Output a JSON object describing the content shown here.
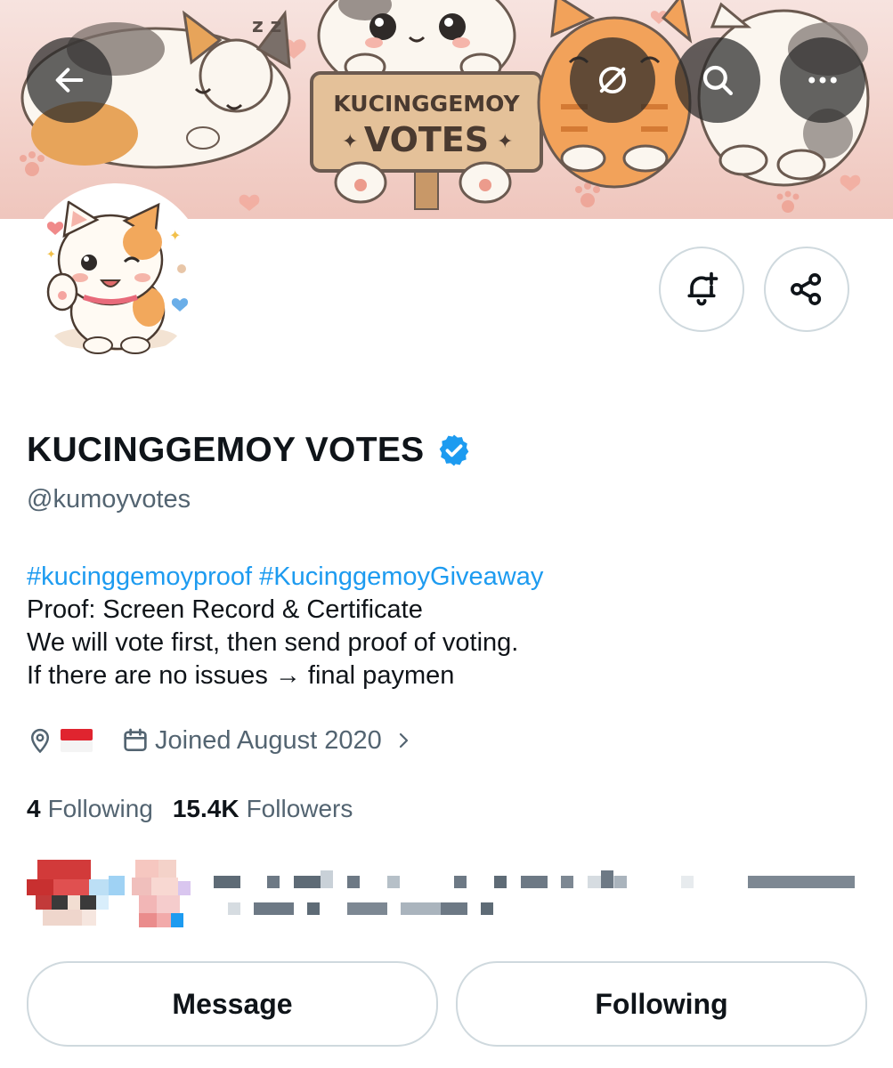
{
  "banner": {
    "sign_line1": "KUCINGGEMOY",
    "sign_line2": "VOTES",
    "zzz": "z z"
  },
  "top_bar": {
    "back_icon": "arrow-left-icon",
    "grok_icon": "slash-circle-icon",
    "search_icon": "search-icon",
    "more_icon": "ellipsis-icon"
  },
  "actions": {
    "notify_icon": "bell-plus-icon",
    "share_icon": "share-icon"
  },
  "profile": {
    "display_name": "KUCINGGEMOY VOTES",
    "verified_icon": "verified-badge-icon",
    "handle": "@kumoyvotes",
    "bio": {
      "hashtag1": "#kucinggemoyproof",
      "hashtag2": "#KucinggemoyGiveaway",
      "line2": "Proof: Screen Record & Certificate",
      "line3": "We will vote first, then send proof of voting.",
      "line4": "If there are no issues → final paymen"
    },
    "location_icon": "map-pin-icon",
    "location_flag": "flag-indonesia-icon",
    "joined_icon": "calendar-icon",
    "joined": "Joined August 2020",
    "joined_chevron": "chevron-right-icon"
  },
  "stats": {
    "following_count": "4",
    "following_label": "Following",
    "followers_count": "15.4K",
    "followers_label": "Followers"
  },
  "buttons": {
    "message": "Message",
    "following": "Following"
  },
  "colors": {
    "accent": "#1d9bf0",
    "secondary_text": "#536471",
    "border": "#cfd9de"
  }
}
